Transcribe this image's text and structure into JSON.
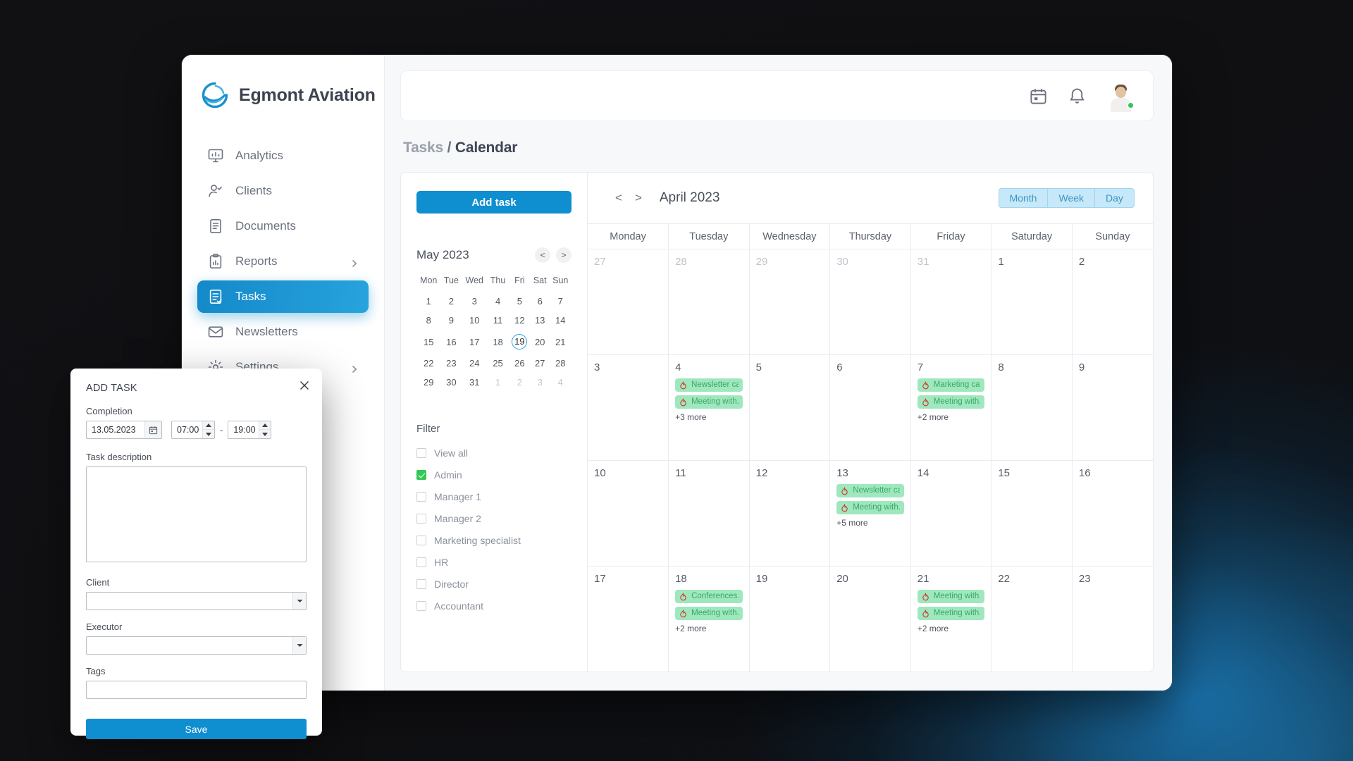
{
  "sidebar": {
    "brand": "Egmont Aviation",
    "items": [
      {
        "label": "Analytics",
        "icon": "analytics-icon",
        "active": false,
        "chevron": false
      },
      {
        "label": "Clients",
        "icon": "clients-icon",
        "active": false,
        "chevron": false
      },
      {
        "label": "Documents",
        "icon": "documents-icon",
        "active": false,
        "chevron": false
      },
      {
        "label": "Reports",
        "icon": "reports-icon",
        "active": false,
        "chevron": true
      },
      {
        "label": "Tasks",
        "icon": "tasks-icon",
        "active": true,
        "chevron": false
      },
      {
        "label": "Newsletters",
        "icon": "newsletters-icon",
        "active": false,
        "chevron": false
      },
      {
        "label": "Settings",
        "icon": "settings-icon",
        "active": false,
        "chevron": true
      }
    ]
  },
  "topbar": {
    "calendar_icon": "calendar-icon",
    "bell_icon": "bell-icon",
    "avatar": "user-avatar",
    "status": "online"
  },
  "breadcrumb": {
    "parent": "Tasks",
    "separator": "/",
    "current": "Calendar"
  },
  "left_panel": {
    "add_task_label": "Add task",
    "mini_calendar": {
      "title": "May 2023",
      "prev_label": "<",
      "next_label": ">",
      "weekdays": [
        "Mon",
        "Tue",
        "Wed",
        "Thu",
        "Fri",
        "Sat",
        "Sun"
      ],
      "selected_day": 19,
      "weeks": [
        [
          {
            "d": 1
          },
          {
            "d": 2
          },
          {
            "d": 3
          },
          {
            "d": 4
          },
          {
            "d": 5
          },
          {
            "d": 6
          },
          {
            "d": 7
          }
        ],
        [
          {
            "d": 8
          },
          {
            "d": 9
          },
          {
            "d": 10
          },
          {
            "d": 11
          },
          {
            "d": 12
          },
          {
            "d": 13
          },
          {
            "d": 14
          }
        ],
        [
          {
            "d": 15
          },
          {
            "d": 16
          },
          {
            "d": 17
          },
          {
            "d": 18
          },
          {
            "d": 19,
            "sel": true
          },
          {
            "d": 20
          },
          {
            "d": 21
          }
        ],
        [
          {
            "d": 22
          },
          {
            "d": 23
          },
          {
            "d": 24
          },
          {
            "d": 25
          },
          {
            "d": 26
          },
          {
            "d": 27
          },
          {
            "d": 28
          }
        ],
        [
          {
            "d": 29
          },
          {
            "d": 30
          },
          {
            "d": 31
          },
          {
            "d": 1,
            "other": true
          },
          {
            "d": 2,
            "other": true
          },
          {
            "d": 3,
            "other": true
          },
          {
            "d": 4,
            "other": true
          }
        ]
      ]
    },
    "filter": {
      "title": "Filter",
      "options": [
        {
          "label": "View all",
          "checked": false
        },
        {
          "label": "Admin",
          "checked": true
        },
        {
          "label": "Manager 1",
          "checked": false
        },
        {
          "label": "Manager 2",
          "checked": false
        },
        {
          "label": "Marketing specialist",
          "checked": false
        },
        {
          "label": "HR",
          "checked": false
        },
        {
          "label": "Director",
          "checked": false
        },
        {
          "label": "Accountant",
          "checked": false
        }
      ]
    }
  },
  "calendar": {
    "prev_label": "<",
    "next_label": ">",
    "month_title": "April 2023",
    "views": [
      {
        "label": "Month",
        "active": false
      },
      {
        "label": "Week",
        "active": false
      },
      {
        "label": "Day",
        "active": false
      }
    ],
    "weekdays": [
      "Monday",
      "Tuesday",
      "Wednesday",
      "Thursday",
      "Friday",
      "Saturday",
      "Sunday"
    ],
    "accent_event_bg": "#9fe8bd",
    "accent_event_text": "#3aa86a",
    "weeks": [
      [
        {
          "day": 27,
          "other": true,
          "events": [],
          "more": ""
        },
        {
          "day": 28,
          "other": true,
          "events": [],
          "more": ""
        },
        {
          "day": 29,
          "other": true,
          "events": [],
          "more": ""
        },
        {
          "day": 30,
          "other": true,
          "events": [],
          "more": ""
        },
        {
          "day": 31,
          "other": true,
          "events": [],
          "more": ""
        },
        {
          "day": 1,
          "other": false,
          "events": [],
          "more": ""
        },
        {
          "day": 2,
          "other": false,
          "events": [],
          "more": ""
        }
      ],
      [
        {
          "day": 3,
          "other": false,
          "events": [],
          "more": ""
        },
        {
          "day": 4,
          "other": false,
          "events": [
            "Newsletter ca..",
            "Meeting with.."
          ],
          "more": "+3 more"
        },
        {
          "day": 5,
          "other": false,
          "events": [],
          "more": ""
        },
        {
          "day": 6,
          "other": false,
          "events": [],
          "more": ""
        },
        {
          "day": 7,
          "other": false,
          "events": [
            "Marketing ca..",
            "Meeting with.."
          ],
          "more": "+2 more"
        },
        {
          "day": 8,
          "other": false,
          "events": [],
          "more": ""
        },
        {
          "day": 9,
          "other": false,
          "events": [],
          "more": ""
        }
      ],
      [
        {
          "day": 10,
          "other": false,
          "events": [],
          "more": ""
        },
        {
          "day": 11,
          "other": false,
          "events": [],
          "more": ""
        },
        {
          "day": 12,
          "other": false,
          "events": [],
          "more": ""
        },
        {
          "day": 13,
          "other": false,
          "events": [
            "Newsletter ca..",
            "Meeting with.."
          ],
          "more": "+5 more"
        },
        {
          "day": 14,
          "other": false,
          "events": [],
          "more": ""
        },
        {
          "day": 15,
          "other": false,
          "events": [],
          "more": ""
        },
        {
          "day": 16,
          "other": false,
          "events": [],
          "more": ""
        }
      ],
      [
        {
          "day": 17,
          "other": false,
          "events": [],
          "more": ""
        },
        {
          "day": 18,
          "other": false,
          "events": [
            "Conferences..",
            "Meeting with.."
          ],
          "more": "+2 more"
        },
        {
          "day": 19,
          "other": false,
          "events": [],
          "more": ""
        },
        {
          "day": 20,
          "other": false,
          "events": [],
          "more": ""
        },
        {
          "day": 21,
          "other": false,
          "events": [
            "Meeting with..",
            "Meeting with.."
          ],
          "more": "+2 more"
        },
        {
          "day": 22,
          "other": false,
          "events": [],
          "more": ""
        },
        {
          "day": 23,
          "other": false,
          "events": [],
          "more": ""
        }
      ]
    ]
  },
  "modal": {
    "title": "ADD TASK",
    "close_icon": "close-icon",
    "completion_label": "Completion",
    "date_value": "13.05.2023",
    "date_icon": "calendar-icon",
    "time_from": "07:00",
    "time_to": "19:00",
    "time_separator": "-",
    "description_label": "Task description",
    "description_value": "",
    "client_label": "Client",
    "client_value": "",
    "executor_label": "Executor",
    "executor_value": "",
    "tags_label": "Tags",
    "tags_value": "",
    "save_label": "Save"
  }
}
